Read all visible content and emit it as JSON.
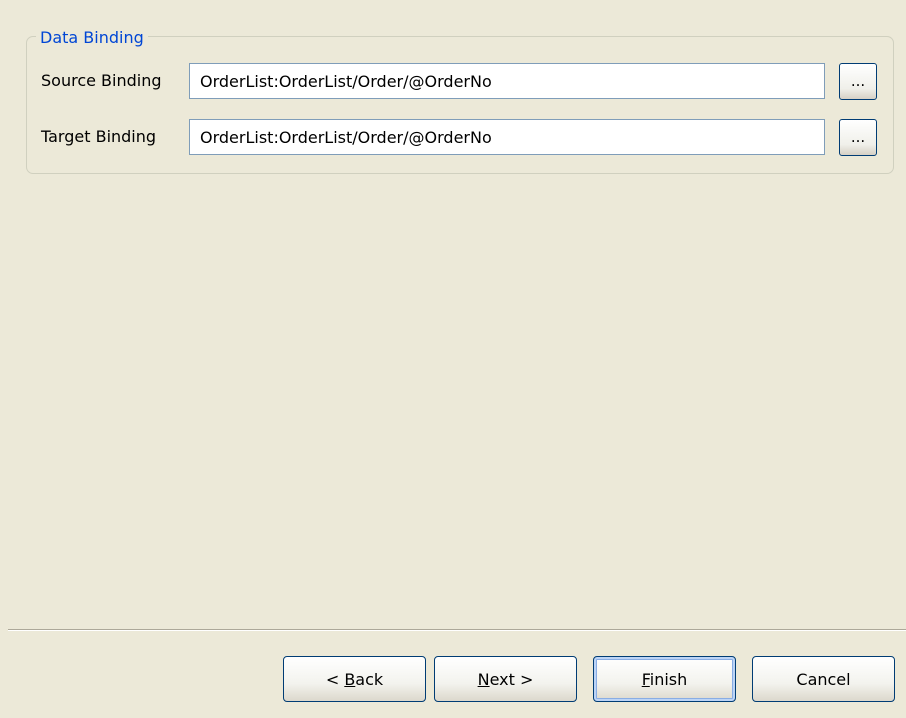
{
  "group": {
    "title": "Data Binding"
  },
  "source_binding": {
    "label": "Source Binding",
    "value": "OrderList:OrderList/Order/@OrderNo",
    "browse_label": "..."
  },
  "target_binding": {
    "label": "Target Binding",
    "value": "OrderList:OrderList/Order/@OrderNo",
    "browse_label": "..."
  },
  "buttons": {
    "back": {
      "prefix": "< ",
      "mnemonic": "B",
      "rest": "ack"
    },
    "next": {
      "mnemonic": "N",
      "rest": "ext >"
    },
    "finish": {
      "mnemonic": "F",
      "rest": "inish"
    },
    "cancel": {
      "label": "Cancel"
    }
  },
  "colors": {
    "dialog_background": "#ece9d8",
    "group_title": "#0046d5",
    "button_border": "#003c74",
    "field_border": "#7f9db9"
  }
}
